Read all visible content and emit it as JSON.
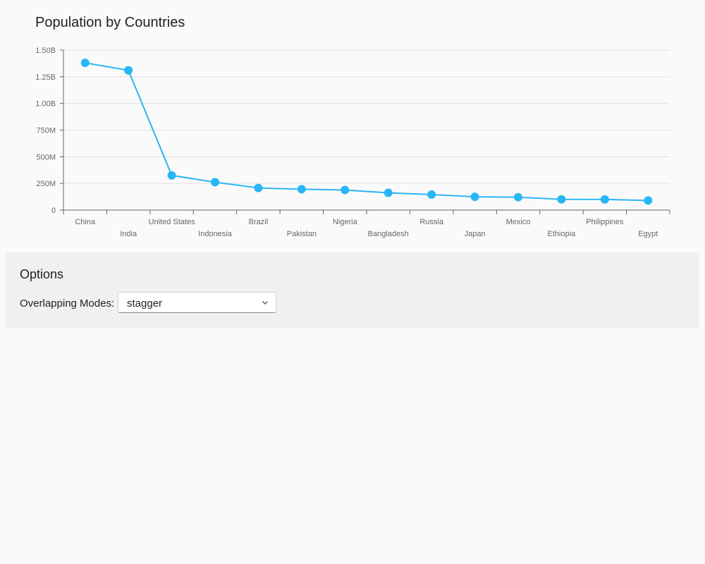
{
  "chart_data": {
    "type": "line",
    "title": "Population by Countries",
    "categories": [
      "China",
      "India",
      "United States",
      "Indonesia",
      "Brazil",
      "Pakistan",
      "Nigeria",
      "Bangladesh",
      "Russia",
      "Japan",
      "Mexico",
      "Ethiopia",
      "Philippines",
      "Egypt"
    ],
    "series": [
      {
        "values": [
          1380000000,
          1310000000,
          325000000,
          262000000,
          207000000,
          196000000,
          188000000,
          162000000,
          145000000,
          125000000,
          121000000,
          101000000,
          100000000,
          90000000
        ]
      }
    ],
    "ylim": [
      0,
      1500000000
    ],
    "yticks": [
      0,
      250000000,
      500000000,
      750000000,
      1000000000,
      1250000000,
      1500000000
    ],
    "ytick_labels": [
      "0",
      "250M",
      "500M",
      "750M",
      "1.00B",
      "1.25B",
      "1.50B"
    ],
    "xlabel": "",
    "ylabel": "",
    "grid": true,
    "label_overlap_mode": "stagger",
    "colors": {
      "line": "#29b6f6",
      "grid": "#e0e0e0",
      "axis": "#666666",
      "tick_text": "#666666"
    }
  },
  "options": {
    "title": "Options",
    "overlap_label": "Overlapping Modes:",
    "overlap_value": "stagger"
  }
}
